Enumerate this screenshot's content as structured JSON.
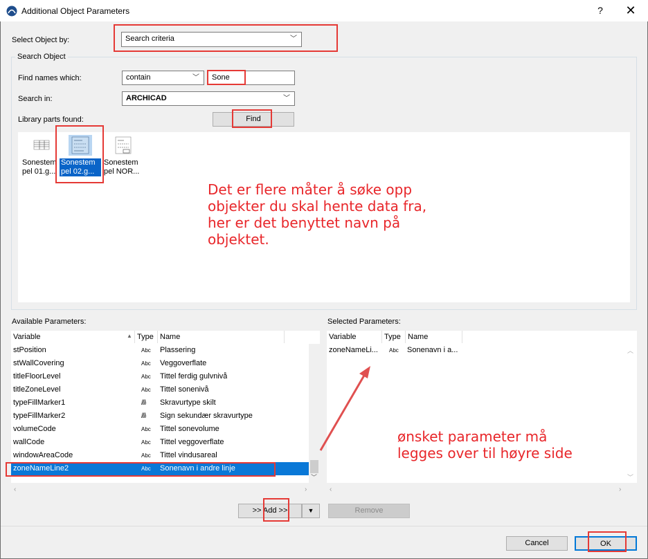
{
  "window": {
    "title": "Additional Object Parameters",
    "help": "?",
    "close": "✕"
  },
  "select_by": {
    "label": "Select Object by:",
    "value": "Search criteria"
  },
  "search_object": {
    "group_label": "Search Object",
    "find_label": "Find names which:",
    "find_mode": "contain",
    "find_text": "Sone",
    "search_in_label": "Search in:",
    "search_in_value": "ARCHICAD",
    "library_found_label": "Library parts found:",
    "find_button": "Find"
  },
  "library_parts": [
    {
      "line1": "Sonestem",
      "line2": "pel 01.g...",
      "selected": false
    },
    {
      "line1": "Sonestem",
      "line2": "pel 02.g...",
      "selected": true
    },
    {
      "line1": "Sonestem",
      "line2": "pel NOR...",
      "selected": false
    }
  ],
  "annotations": {
    "top": [
      "Det er flere måter å søke opp",
      "objekter du skal hente data fra,",
      "her er det benyttet navn på",
      "objektet."
    ],
    "bottom": [
      "ønsket parameter må",
      "legges over til høyre side"
    ]
  },
  "available": {
    "label": "Available Parameters:",
    "col_variable": "Variable",
    "col_type": "Type",
    "col_name": "Name",
    "rows": [
      {
        "variable": "stPosition",
        "type": "Abc",
        "name": "Plassering"
      },
      {
        "variable": "stWallCovering",
        "type": "Abc",
        "name": "Veggoverflate"
      },
      {
        "variable": "titleFloorLevel",
        "type": "Abc",
        "name": "Tittel ferdig gulvnivå"
      },
      {
        "variable": "titleZoneLevel",
        "type": "Abc",
        "name": "Tittel sonenivå"
      },
      {
        "variable": "typeFillMarker1",
        "type": "////",
        "name": "Skravurtype skilt"
      },
      {
        "variable": "typeFillMarker2",
        "type": "////",
        "name": "Sign sekundær skravurtype"
      },
      {
        "variable": "volumeCode",
        "type": "Abc",
        "name": "Tittel sonevolume"
      },
      {
        "variable": "wallCode",
        "type": "Abc",
        "name": "Tittel veggoverflate"
      },
      {
        "variable": "windowAreaCode",
        "type": "Abc",
        "name": "Tittel vindusareal"
      },
      {
        "variable": "zoneNameLine2",
        "type": "Abc",
        "name": "Sonenavn i andre linje"
      }
    ]
  },
  "selected": {
    "label": "Selected Parameters:",
    "col_variable": "Variable",
    "col_type": "Type",
    "col_name": "Name",
    "rows": [
      {
        "variable": "zoneNameLi...",
        "type": "Abc",
        "name": "Sonenavn i a..."
      }
    ]
  },
  "buttons": {
    "add": ">> Add >>",
    "add_menu": "▼",
    "remove": "Remove",
    "cancel": "Cancel",
    "ok": "OK"
  },
  "colors": {
    "highlight": "#e53935",
    "selection": "#0a78d7",
    "annotation": "#e8262a"
  }
}
